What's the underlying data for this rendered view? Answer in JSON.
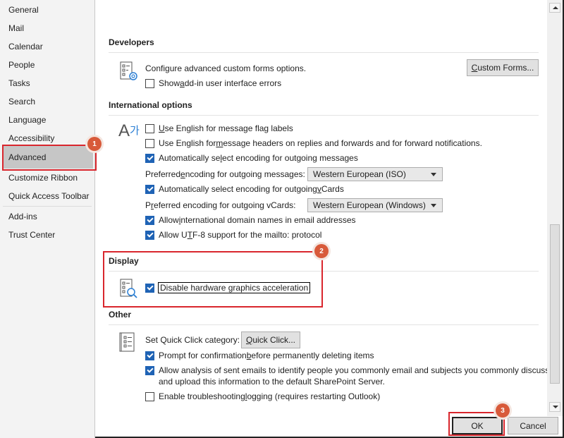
{
  "sidebar": {
    "items": [
      {
        "label": "General"
      },
      {
        "label": "Mail"
      },
      {
        "label": "Calendar"
      },
      {
        "label": "People"
      },
      {
        "label": "Tasks"
      },
      {
        "label": "Search"
      },
      {
        "label": "Language"
      },
      {
        "label": "Accessibility"
      },
      {
        "label": "Advanced",
        "selected": true
      },
      {
        "label": "Customize Ribbon"
      },
      {
        "label": "Quick Access Toolbar"
      },
      {
        "label": "Add-ins"
      },
      {
        "label": "Trust Center"
      }
    ]
  },
  "developers": {
    "title": "Developers",
    "description": "Configure advanced custom forms options.",
    "custom_forms_button": {
      "pre": "",
      "accel": "C",
      "post": "ustom Forms..."
    },
    "show_addin_errors": {
      "pre": "Show ",
      "accel": "a",
      "post": "dd-in user interface errors",
      "checked": false
    },
    "icon": "forms-gear-icon"
  },
  "international": {
    "title": "International options",
    "icon": "language-icon",
    "icon_glyph": "A가",
    "options": [
      {
        "pre": "",
        "accel": "U",
        "post": "se English for message flag labels",
        "checked": false
      },
      {
        "pre": "Use English for ",
        "accel": "m",
        "post": "essage headers on replies and forwards and for forward notifications.",
        "checked": false
      },
      {
        "pre": "Automatically se",
        "accel": "l",
        "post": "ect encoding for outgoing messages",
        "checked": true
      }
    ],
    "pref_msg_label": {
      "pre": "Preferred ",
      "accel": "e",
      "post": "ncoding for outgoing messages:"
    },
    "pref_msg_value": "Western European (ISO)",
    "auto_vcards": {
      "pre": "Automatically select encoding for outgoing ",
      "accel": "v",
      "post": "Cards",
      "checked": true
    },
    "pref_vcards_label": {
      "pre": "P",
      "accel": "r",
      "post": "eferred encoding for outgoing vCards:"
    },
    "pref_vcards_value": "Western European (Windows)",
    "allow_idn": {
      "pre": "Allow ",
      "accel": "i",
      "post": "nternational domain names in email addresses",
      "checked": true
    },
    "allow_utf8": {
      "pre": "Allow U",
      "accel": "T",
      "post": "F-8 support for the mailto: protocol",
      "checked": true
    }
  },
  "display": {
    "title": "Display",
    "icon": "display-search-icon",
    "disable_hw_accel": {
      "pre": "Disable hardware ",
      "accel": "g",
      "post": "raphics acceleration",
      "checked": true
    }
  },
  "other": {
    "title": "Other",
    "icon": "list-icon",
    "quick_click_label": "Set Quick Click category:",
    "quick_click_button": {
      "pre": "",
      "accel": "Q",
      "post": "uick Click..."
    },
    "prompt_delete": {
      "pre": "Prompt for confirmation ",
      "accel": "b",
      "post": "efore permanently deleting items",
      "checked": true
    },
    "allow_analysis": {
      "line1": "Allow analysis of sent emails to identify people you commonly email and subjects you commonly discuss,",
      "line2": "and upload this information to the default SharePoint Server.",
      "checked": true
    },
    "troubleshoot": {
      "pre": "Enable troubleshooting ",
      "accel": "l",
      "post": "ogging (requires restarting Outlook)",
      "checked": false
    }
  },
  "footer": {
    "ok_label": "OK",
    "cancel_label": "Cancel"
  },
  "annotations": {
    "step1": "1",
    "step2": "2",
    "step3": "3",
    "color": "#d9262d",
    "badge_color": "#d85a3a"
  },
  "colors": {
    "checkbox_checked": "#1f63b5",
    "selected_nav": "#c6c6c6",
    "sidebar_bg": "#f3f3f3"
  }
}
